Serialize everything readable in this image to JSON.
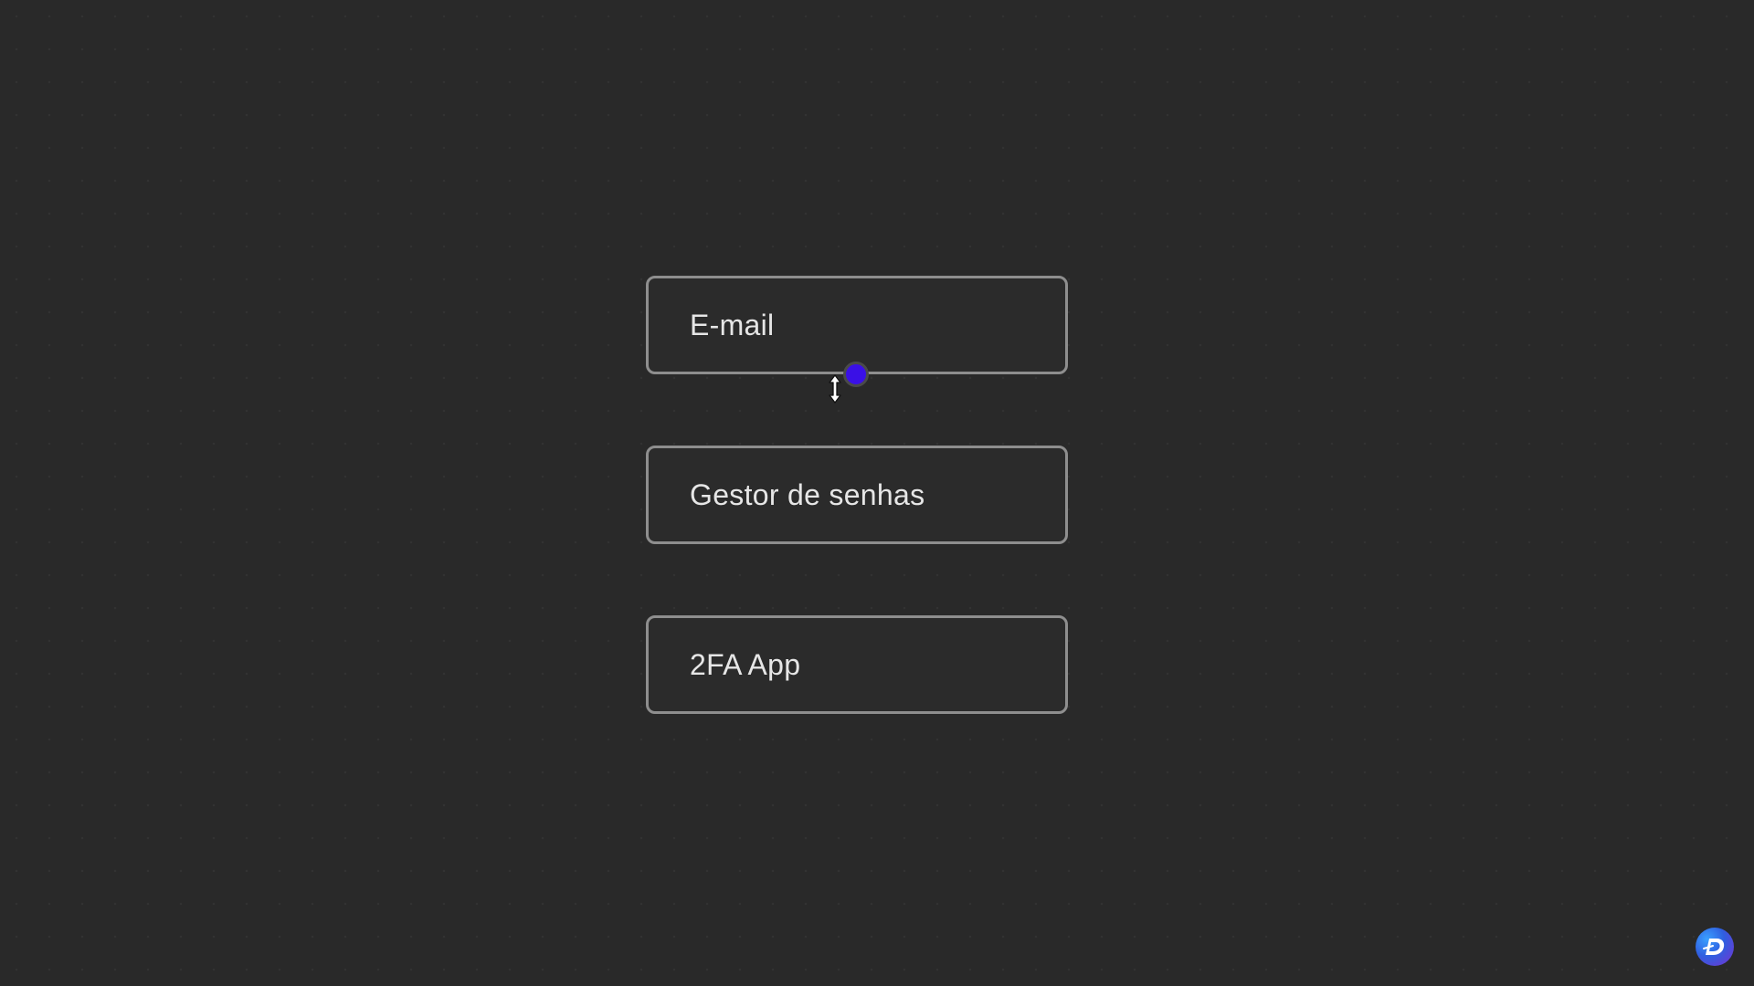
{
  "canvas": {
    "background_color": "#292929",
    "nodes": [
      {
        "label": "E-mail"
      },
      {
        "label": "Gestor de senhas"
      },
      {
        "label": "2FA App"
      }
    ],
    "connector_handle": {
      "color": "#3a10e6"
    },
    "cursor": {
      "icon": "vertical-resize-cursor-icon"
    }
  },
  "branding": {
    "logo_icon": "brand-d-logo-icon",
    "logo_letter": "D"
  },
  "colors": {
    "node_border": "#8e8e8e",
    "node_text": "#e6e6e6",
    "accent": "#3a10e6"
  }
}
